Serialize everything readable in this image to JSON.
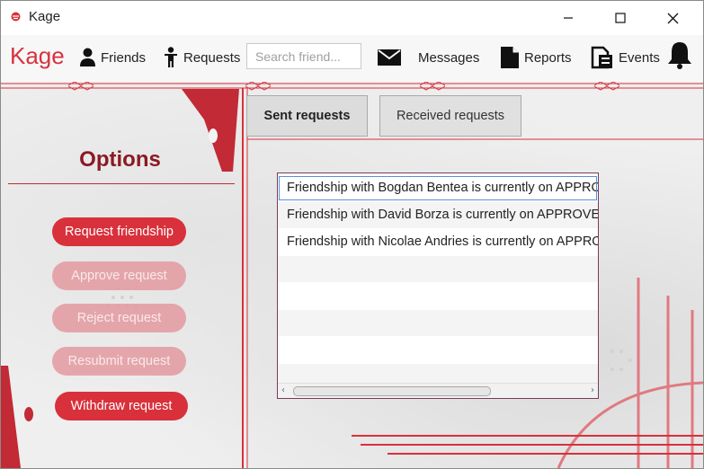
{
  "window": {
    "title": "Kage",
    "controls": {
      "minimize": "—",
      "maximize": "☐",
      "close": "✕"
    }
  },
  "navbar": {
    "brand": "Kage",
    "items": [
      {
        "label": "Friends",
        "icon": "person-icon"
      },
      {
        "label": "Requests",
        "icon": "person-standing-icon"
      },
      {
        "label": "Messages",
        "icon": "envelope-icon"
      },
      {
        "label": "Reports",
        "icon": "document-icon"
      },
      {
        "label": "Events",
        "icon": "calendar-events-icon"
      }
    ],
    "search_placeholder": "Search friend...",
    "notification_icon": "bell-icon"
  },
  "options": {
    "title": "Options",
    "buttons": [
      {
        "label": "Request friendship",
        "enabled": true
      },
      {
        "label": "Approve request",
        "enabled": false
      },
      {
        "label": "Reject request",
        "enabled": false
      },
      {
        "label": "Resubmit request",
        "enabled": false
      },
      {
        "label": "Withdraw request",
        "enabled": true
      }
    ]
  },
  "tabs": [
    {
      "label": "Sent requests",
      "selected": true
    },
    {
      "label": "Received requests",
      "selected": false
    }
  ],
  "requests_list": {
    "items": [
      "Friendship with Bogdan Bentea is currently on APPROVED",
      "Friendship with David Borza is currently on APPROVED",
      "Friendship with Nicolae Andries is currently on APPROVED"
    ]
  },
  "colors": {
    "accent": "#d8313b",
    "accent_dark": "#8b1a22",
    "accent_light": "#e49aa0"
  }
}
